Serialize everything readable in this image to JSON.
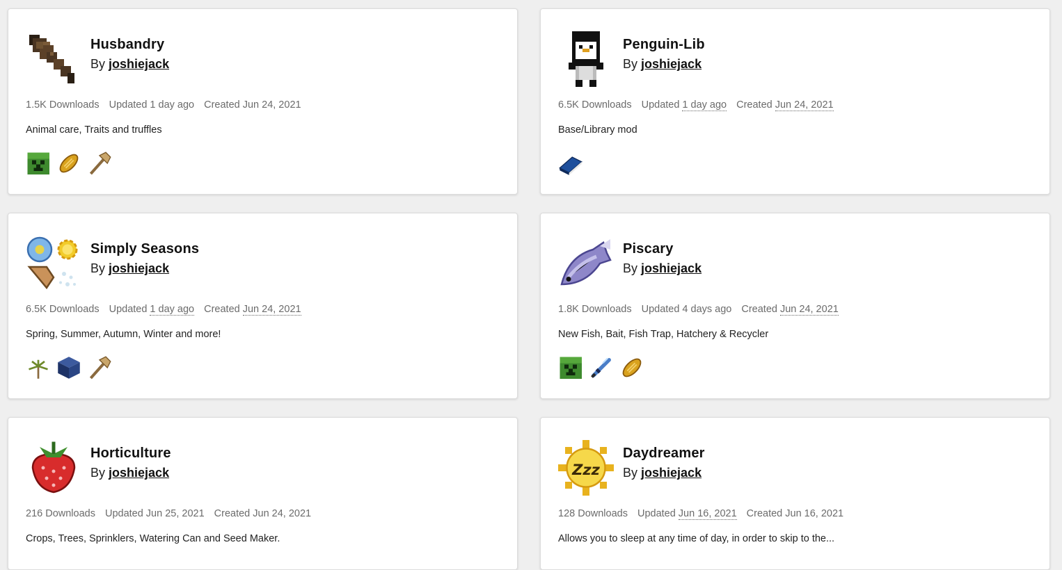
{
  "by_prefix": "By",
  "mods": [
    {
      "title": "Husbandry",
      "author": "joshiejack",
      "downloads": "1.5K Downloads",
      "updated_label": "Updated",
      "updated": "1 day ago",
      "created_label": "Created",
      "created": "Jun 24, 2021",
      "description": "Animal care, Traits and truffles",
      "logo_icon": "brush-icon",
      "categories": [
        "creeper-icon",
        "bread-icon",
        "hammer-icon"
      ]
    },
    {
      "title": "Penguin-Lib",
      "author": "joshiejack",
      "downloads": "6.5K Downloads",
      "updated_label": "Updated",
      "updated": "1 day ago",
      "created_label": "Created",
      "created": "Jun 24, 2021",
      "description": "Base/Library mod",
      "logo_icon": "penguin-icon",
      "categories": [
        "book-icon"
      ]
    },
    {
      "title": "Simply Seasons",
      "author": "joshiejack",
      "downloads": "6.5K Downloads",
      "updated_label": "Updated",
      "updated": "1 day ago",
      "created_label": "Created",
      "created": "Jun 24, 2021",
      "description": "Spring, Summer, Autumn, Winter and more!",
      "logo_icon": "seasons-icon",
      "categories": [
        "palm-icon",
        "block-icon",
        "hammer-icon"
      ]
    },
    {
      "title": "Piscary",
      "author": "joshiejack",
      "downloads": "1.8K Downloads",
      "updated_label": "Updated",
      "updated": "4 days ago",
      "created_label": "Created",
      "created": "Jun 24, 2021",
      "description": "New Fish, Bait, Fish Trap, Hatchery & Recycler",
      "logo_icon": "fish-icon",
      "categories": [
        "creeper-icon",
        "sword-icon",
        "bread-icon"
      ]
    },
    {
      "title": "Horticulture",
      "author": "joshiejack",
      "downloads": "216 Downloads",
      "updated_label": "Updated",
      "updated": "Jun 25, 2021",
      "created_label": "Created",
      "created": "Jun 24, 2021",
      "description": "Crops, Trees, Sprinklers, Watering Can and Seed Maker.",
      "logo_icon": "strawberry-icon",
      "categories": []
    },
    {
      "title": "Daydreamer",
      "author": "joshiejack",
      "downloads": "128 Downloads",
      "updated_label": "Updated",
      "updated": "Jun 16, 2021",
      "created_label": "Created",
      "created": "Jun 16, 2021",
      "description": "Allows you to sleep at any time of day, in order to skip to the...",
      "logo_icon": "sleeping-sun-icon",
      "categories": []
    }
  ]
}
